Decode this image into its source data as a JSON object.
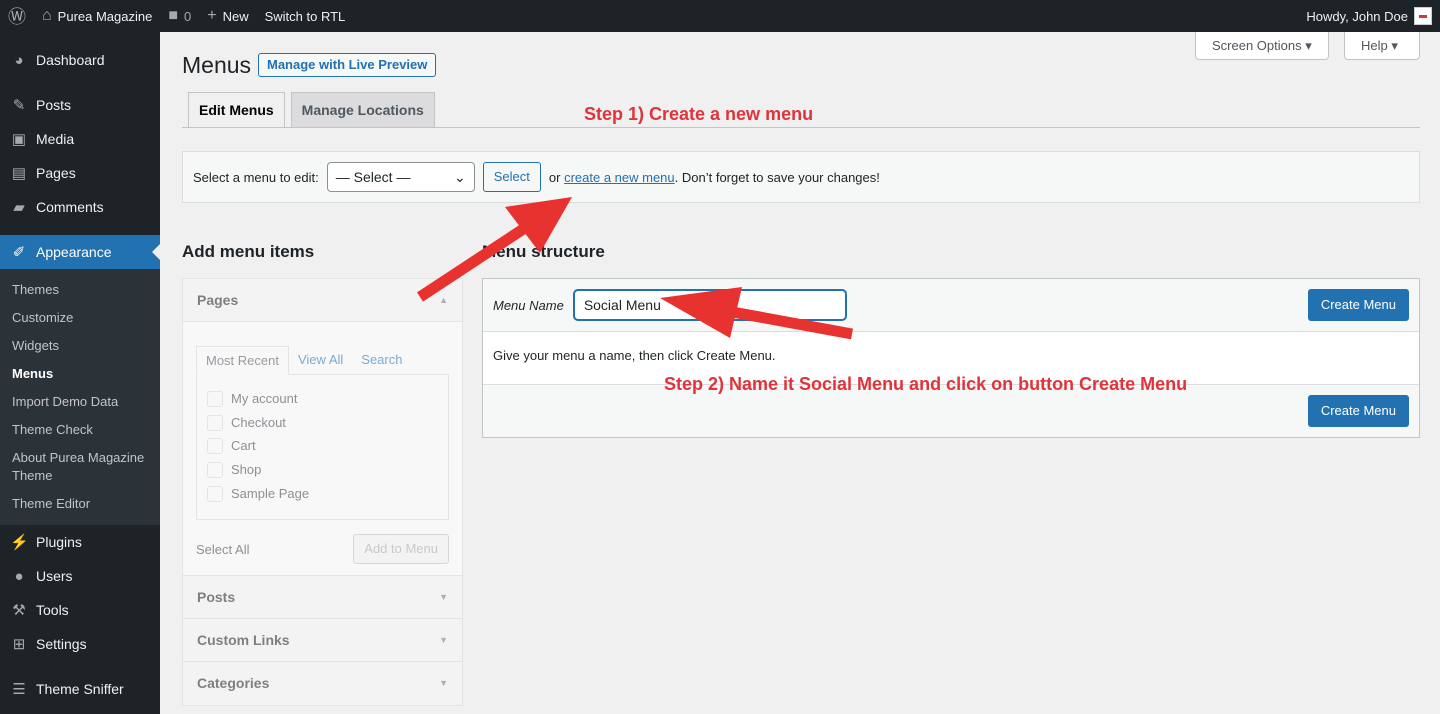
{
  "admin_bar": {
    "site": "Purea Magazine",
    "comments": "0",
    "new": "New",
    "rtl": "Switch to RTL",
    "howdy": "Howdy, John Doe"
  },
  "sidebar": {
    "items": [
      {
        "label": "Dashboard",
        "icon": "dashboard-icon"
      },
      {
        "label": "Posts",
        "icon": "pin-icon"
      },
      {
        "label": "Media",
        "icon": "media-icon"
      },
      {
        "label": "Pages",
        "icon": "pages-icon"
      },
      {
        "label": "Comments",
        "icon": "comment-icon"
      },
      {
        "label": "Appearance",
        "icon": "brush-icon"
      }
    ],
    "submenu": [
      "Themes",
      "Customize",
      "Widgets",
      "Menus",
      "Import Demo Data",
      "Theme Check",
      "About Purea Magazine Theme",
      "Theme Editor"
    ],
    "items2": [
      {
        "label": "Plugins"
      },
      {
        "label": "Users"
      },
      {
        "label": "Tools"
      },
      {
        "label": "Settings"
      },
      {
        "label": "Theme Sniffer"
      }
    ]
  },
  "header": {
    "title": "Menus",
    "live_preview": "Manage with Live Preview",
    "screen_options": "Screen Options",
    "help": "Help"
  },
  "tabs": [
    "Edit Menus",
    "Manage Locations"
  ],
  "manage": {
    "label": "Select a menu to edit:",
    "select_value": "— Select —",
    "select_button": "Select",
    "or": "or",
    "link": "create a new menu",
    "suffix": ". Don’t forget to save your changes!"
  },
  "add_items": {
    "title": "Add menu items",
    "sections": [
      "Pages",
      "Posts",
      "Custom Links",
      "Categories"
    ],
    "inner_tabs": [
      "Most Recent",
      "View All",
      "Search"
    ],
    "pages": [
      "My account",
      "Checkout",
      "Cart",
      "Shop",
      "Sample Page"
    ],
    "select_all": "Select All",
    "add_button": "Add to Menu"
  },
  "structure": {
    "title": "Menu structure",
    "name_label": "Menu Name",
    "name_value": "Social Menu",
    "create": "Create Menu",
    "hint": "Give your menu a name, then click Create Menu."
  },
  "annotations": {
    "step1": "Step 1) Create a new menu",
    "step2": "Step 2) Name it Social Menu and click on button Create Menu",
    "color": "#e0333a"
  },
  "colors": {
    "accent": "#2271b1",
    "sidebar": "#1d2327"
  }
}
